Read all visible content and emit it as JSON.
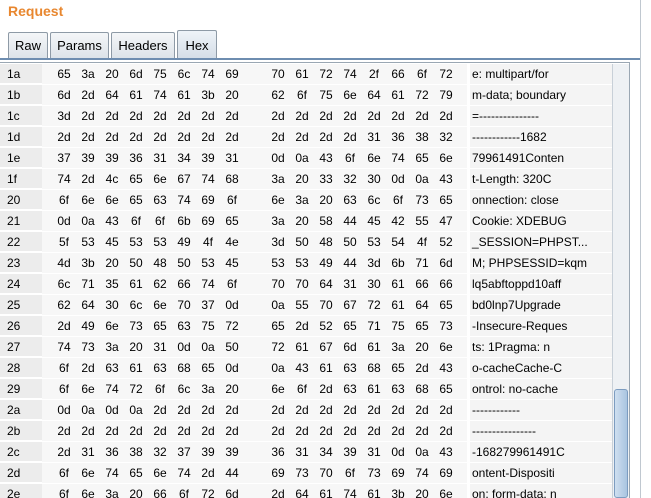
{
  "panel": {
    "title": "Request"
  },
  "tabs": [
    {
      "label": "Raw",
      "active": false
    },
    {
      "label": "Params",
      "active": false
    },
    {
      "label": "Headers",
      "active": false
    },
    {
      "label": "Hex",
      "active": true
    }
  ],
  "hex_rows": [
    {
      "offset": "1a",
      "bytes": [
        "65",
        "3a",
        "20",
        "6d",
        "75",
        "6c",
        "74",
        "69",
        "70",
        "61",
        "72",
        "74",
        "2f",
        "66",
        "6f",
        "72"
      ],
      "ascii": "e: multipart/for"
    },
    {
      "offset": "1b",
      "bytes": [
        "6d",
        "2d",
        "64",
        "61",
        "74",
        "61",
        "3b",
        "20",
        "62",
        "6f",
        "75",
        "6e",
        "64",
        "61",
        "72",
        "79"
      ],
      "ascii": "m-data; boundary"
    },
    {
      "offset": "1c",
      "bytes": [
        "3d",
        "2d",
        "2d",
        "2d",
        "2d",
        "2d",
        "2d",
        "2d",
        "2d",
        "2d",
        "2d",
        "2d",
        "2d",
        "2d",
        "2d",
        "2d"
      ],
      "ascii": "=---------------"
    },
    {
      "offset": "1d",
      "bytes": [
        "2d",
        "2d",
        "2d",
        "2d",
        "2d",
        "2d",
        "2d",
        "2d",
        "2d",
        "2d",
        "2d",
        "2d",
        "31",
        "36",
        "38",
        "32"
      ],
      "ascii": "------------1682"
    },
    {
      "offset": "1e",
      "bytes": [
        "37",
        "39",
        "39",
        "36",
        "31",
        "34",
        "39",
        "31",
        "0d",
        "0a",
        "43",
        "6f",
        "6e",
        "74",
        "65",
        "6e"
      ],
      "ascii": "79961491Conten"
    },
    {
      "offset": "1f",
      "bytes": [
        "74",
        "2d",
        "4c",
        "65",
        "6e",
        "67",
        "74",
        "68",
        "3a",
        "20",
        "33",
        "32",
        "30",
        "0d",
        "0a",
        "43"
      ],
      "ascii": "t-Length: 320C"
    },
    {
      "offset": "20",
      "bytes": [
        "6f",
        "6e",
        "6e",
        "65",
        "63",
        "74",
        "69",
        "6f",
        "6e",
        "3a",
        "20",
        "63",
        "6c",
        "6f",
        "73",
        "65"
      ],
      "ascii": "onnection: close"
    },
    {
      "offset": "21",
      "bytes": [
        "0d",
        "0a",
        "43",
        "6f",
        "6f",
        "6b",
        "69",
        "65",
        "3a",
        "20",
        "58",
        "44",
        "45",
        "42",
        "55",
        "47"
      ],
      "ascii": "Cookie: XDEBUG"
    },
    {
      "offset": "22",
      "bytes": [
        "5f",
        "53",
        "45",
        "53",
        "53",
        "49",
        "4f",
        "4e",
        "3d",
        "50",
        "48",
        "50",
        "53",
        "54",
        "4f",
        "52"
      ],
      "ascii": "_SESSION=PHPST..."
    },
    {
      "offset": "23",
      "bytes": [
        "4d",
        "3b",
        "20",
        "50",
        "48",
        "50",
        "53",
        "45",
        "53",
        "53",
        "49",
        "44",
        "3d",
        "6b",
        "71",
        "6d"
      ],
      "ascii": "M; PHPSESSID=kqm"
    },
    {
      "offset": "24",
      "bytes": [
        "6c",
        "71",
        "35",
        "61",
        "62",
        "66",
        "74",
        "6f",
        "70",
        "70",
        "64",
        "31",
        "30",
        "61",
        "66",
        "66"
      ],
      "ascii": "lq5abftoppd10aff"
    },
    {
      "offset": "25",
      "bytes": [
        "62",
        "64",
        "30",
        "6c",
        "6e",
        "70",
        "37",
        "0d",
        "0a",
        "55",
        "70",
        "67",
        "72",
        "61",
        "64",
        "65"
      ],
      "ascii": "bd0lnp7Upgrade"
    },
    {
      "offset": "26",
      "bytes": [
        "2d",
        "49",
        "6e",
        "73",
        "65",
        "63",
        "75",
        "72",
        "65",
        "2d",
        "52",
        "65",
        "71",
        "75",
        "65",
        "73"
      ],
      "ascii": "-Insecure-Reques"
    },
    {
      "offset": "27",
      "bytes": [
        "74",
        "73",
        "3a",
        "20",
        "31",
        "0d",
        "0a",
        "50",
        "72",
        "61",
        "67",
        "6d",
        "61",
        "3a",
        "20",
        "6e"
      ],
      "ascii": "ts: 1Pragma: n"
    },
    {
      "offset": "28",
      "bytes": [
        "6f",
        "2d",
        "63",
        "61",
        "63",
        "68",
        "65",
        "0d",
        "0a",
        "43",
        "61",
        "63",
        "68",
        "65",
        "2d",
        "43"
      ],
      "ascii": "o-cacheCache-C"
    },
    {
      "offset": "29",
      "bytes": [
        "6f",
        "6e",
        "74",
        "72",
        "6f",
        "6c",
        "3a",
        "20",
        "6e",
        "6f",
        "2d",
        "63",
        "61",
        "63",
        "68",
        "65"
      ],
      "ascii": "ontrol: no-cache"
    },
    {
      "offset": "2a",
      "bytes": [
        "0d",
        "0a",
        "0d",
        "0a",
        "2d",
        "2d",
        "2d",
        "2d",
        "2d",
        "2d",
        "2d",
        "2d",
        "2d",
        "2d",
        "2d",
        "2d"
      ],
      "ascii": "------------"
    },
    {
      "offset": "2b",
      "bytes": [
        "2d",
        "2d",
        "2d",
        "2d",
        "2d",
        "2d",
        "2d",
        "2d",
        "2d",
        "2d",
        "2d",
        "2d",
        "2d",
        "2d",
        "2d",
        "2d"
      ],
      "ascii": "----------------"
    },
    {
      "offset": "2c",
      "bytes": [
        "2d",
        "31",
        "36",
        "38",
        "32",
        "37",
        "39",
        "39",
        "36",
        "31",
        "34",
        "39",
        "31",
        "0d",
        "0a",
        "43"
      ],
      "ascii": "-168279961491C"
    },
    {
      "offset": "2d",
      "bytes": [
        "6f",
        "6e",
        "74",
        "65",
        "6e",
        "74",
        "2d",
        "44",
        "69",
        "73",
        "70",
        "6f",
        "73",
        "69",
        "74",
        "69"
      ],
      "ascii": "ontent-Dispositi"
    },
    {
      "offset": "2e",
      "bytes": [
        "6f",
        "6e",
        "3a",
        "20",
        "66",
        "6f",
        "72",
        "6d",
        "2d",
        "64",
        "61",
        "74",
        "61",
        "3b",
        "20",
        "6e"
      ],
      "ascii": "on: form-data; n"
    }
  ],
  "colors": {
    "title": "#e8872f",
    "row_header_bg": "#ececec",
    "tab_border": "#8e9aa6"
  }
}
